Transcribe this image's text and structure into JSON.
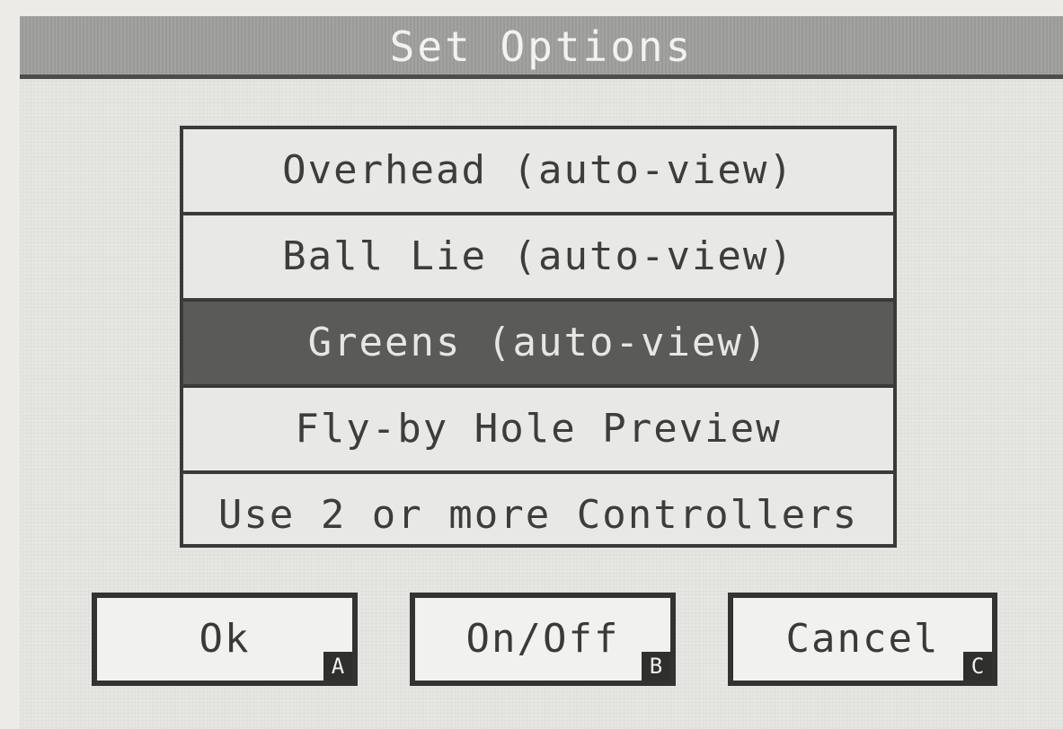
{
  "dialog": {
    "title": "Set Options",
    "options": [
      {
        "label": "Overhead (auto-view)",
        "selected": false
      },
      {
        "label": "Ball Lie (auto-view)",
        "selected": false
      },
      {
        "label": "Greens (auto-view)",
        "selected": true
      },
      {
        "label": "Fly-by Hole Preview",
        "selected": false
      },
      {
        "label": "Use 2 or more Controllers",
        "selected": false
      }
    ],
    "buttons": {
      "ok": {
        "label": "Ok",
        "key": "A"
      },
      "onoff": {
        "label": "On/Off",
        "key": "B"
      },
      "cancel": {
        "label": "Cancel",
        "key": "C"
      }
    }
  },
  "colors": {
    "title_bar": "#9a9a98",
    "selected_item": "#5a5a59",
    "background": "#e6e6e3",
    "border": "#333332"
  }
}
